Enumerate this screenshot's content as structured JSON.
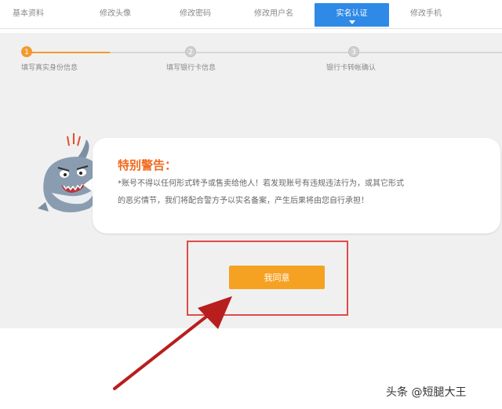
{
  "tabs": [
    {
      "label": "基本资料",
      "active": false
    },
    {
      "label": "修改头像",
      "active": false
    },
    {
      "label": "修改密码",
      "active": false
    },
    {
      "label": "修改用户名",
      "active": false
    },
    {
      "label": "实名认证",
      "active": true
    },
    {
      "label": "修改手机",
      "active": false
    }
  ],
  "steps": [
    {
      "number": "1",
      "label": "填写真实身份信息",
      "status": "current"
    },
    {
      "number": "2",
      "label": "填写银行卡信息",
      "status": "pending"
    },
    {
      "number": "3",
      "label": "银行卡转帐确认",
      "status": "pending"
    }
  ],
  "warning": {
    "title": "特别警告：",
    "line1": "*账号不得以任何形式转予或售卖给他人！若发现账号有违规违法行为，或其它形式",
    "line2": "的恶劣情节，我们将配合警方予以实名备案，产生后果将由您自行承担！"
  },
  "agree_button": "我同意",
  "watermark": "头条 @短腿大王",
  "colors": {
    "tab_active": "#2e8ae6",
    "step_done": "#f29a2e",
    "warning_title": "#f06a1d",
    "button": "#f5a122",
    "highlight": "#e04a4a",
    "arrow": "#b81e1e"
  },
  "icons": {
    "mascot": "shark-mascot-icon",
    "arrow": "red-pointer-arrow"
  }
}
